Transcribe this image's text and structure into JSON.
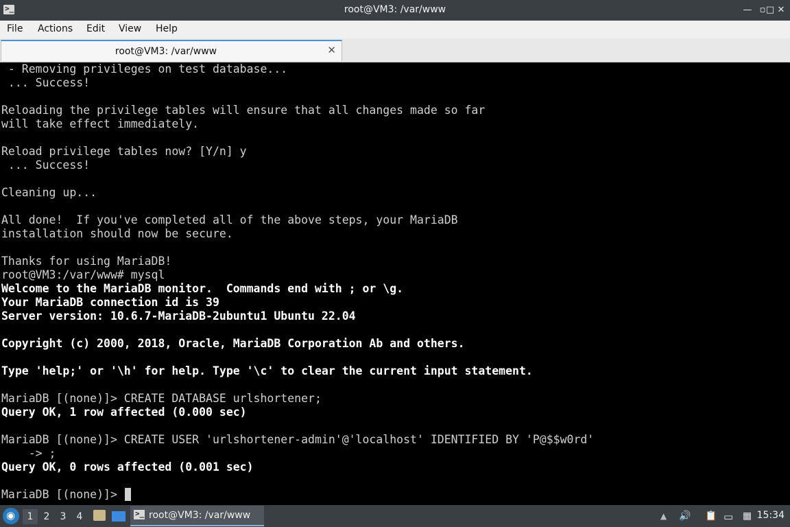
{
  "window": {
    "title": "root@VM3: /var/www",
    "app_icon_glyph": ">_",
    "minimize_glyph": "—",
    "restore_glyph": "▫",
    "maximize_glyph": "□",
    "close_glyph": "✕"
  },
  "menu": {
    "file": "File",
    "actions": "Actions",
    "edit": "Edit",
    "view": "View",
    "help": "Help"
  },
  "tab": {
    "label": "root@VM3: /var/www",
    "close_glyph": "✕"
  },
  "terminal": {
    "lines": [
      {
        "text": " - Removing privileges on test database...",
        "bold": false
      },
      {
        "text": " ... Success!",
        "bold": false
      },
      {
        "text": "",
        "bold": false
      },
      {
        "text": "Reloading the privilege tables will ensure that all changes made so far",
        "bold": false
      },
      {
        "text": "will take effect immediately.",
        "bold": false
      },
      {
        "text": "",
        "bold": false
      },
      {
        "text": "Reload privilege tables now? [Y/n] y",
        "bold": false
      },
      {
        "text": " ... Success!",
        "bold": false
      },
      {
        "text": "",
        "bold": false
      },
      {
        "text": "Cleaning up...",
        "bold": false
      },
      {
        "text": "",
        "bold": false
      },
      {
        "text": "All done!  If you've completed all of the above steps, your MariaDB",
        "bold": false
      },
      {
        "text": "installation should now be secure.",
        "bold": false
      },
      {
        "text": "",
        "bold": false
      },
      {
        "text": "Thanks for using MariaDB!",
        "bold": false
      },
      {
        "text": "root@VM3:/var/www# mysql",
        "bold": false
      },
      {
        "text": "Welcome to the MariaDB monitor.  Commands end with ; or \\g.",
        "bold": true
      },
      {
        "text": "Your MariaDB connection id is 39",
        "bold": true
      },
      {
        "text": "Server version: 10.6.7-MariaDB-2ubuntu1 Ubuntu 22.04",
        "bold": true
      },
      {
        "text": "",
        "bold": false
      },
      {
        "text": "Copyright (c) 2000, 2018, Oracle, MariaDB Corporation Ab and others.",
        "bold": true
      },
      {
        "text": "",
        "bold": false
      },
      {
        "text": "Type 'help;' or '\\h' for help. Type '\\c' to clear the current input statement.",
        "bold": true
      },
      {
        "text": "",
        "bold": false
      },
      {
        "text": "MariaDB [(none)]> CREATE DATABASE urlshortener;",
        "bold": false
      },
      {
        "text": "Query OK, 1 row affected (0.000 sec)",
        "bold": true
      },
      {
        "text": "",
        "bold": false
      },
      {
        "text": "MariaDB [(none)]> CREATE USER 'urlshortener-admin'@'localhost' IDENTIFIED BY 'P@$$w0rd'",
        "bold": false
      },
      {
        "text": "    -> ;",
        "bold": false
      },
      {
        "text": "Query OK, 0 rows affected (0.001 sec)",
        "bold": true
      },
      {
        "text": "",
        "bold": false
      },
      {
        "text": "MariaDB [(none)]> ",
        "bold": false
      }
    ]
  },
  "taskbar": {
    "start_glyph": "◉",
    "workspaces": [
      "1",
      "2",
      "3",
      "4"
    ],
    "active_workspace": "1",
    "task_label": "root@VM3: /var/www",
    "task_icon_glyph": ">_",
    "tray": {
      "battery_glyph": "▲",
      "volume_glyph": "🔊",
      "clipboard_glyph": "📋",
      "network_glyph": "▭",
      "notes_glyph": "▦"
    },
    "clock": "15:34"
  }
}
